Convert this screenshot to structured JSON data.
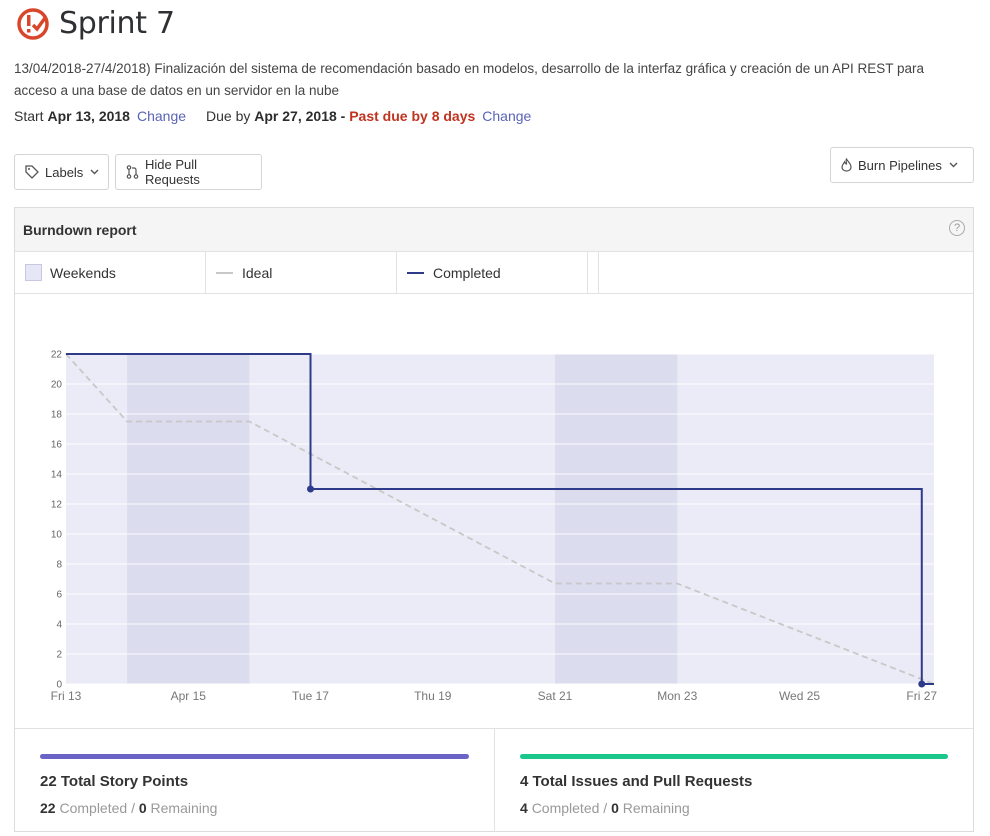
{
  "header": {
    "title": "Sprint 7",
    "logo_icon": "milestone-check-icon",
    "accent": "#d9472b"
  },
  "description": "13/04/2018-27/4/2018) Finalización del sistema de recomendación basado en modelos, desarrollo de la interfaz gráfica y creación de un API REST para acceso a una base de datos en un servidor en la nube",
  "dates": {
    "start_label": "Start",
    "start_value": "Apr 13, 2018",
    "change": "Change",
    "due_label": "Due by",
    "due_value": "Apr 27, 2018",
    "separator": "-",
    "past_due": "Past due by 8 days"
  },
  "toolbar": {
    "labels": "Labels",
    "hide_prs": "Hide Pull Requests",
    "burn": "Burn Pipelines"
  },
  "report": {
    "title": "Burndown report",
    "help": "?",
    "legend": {
      "weekends": "Weekends",
      "ideal": "Ideal",
      "completed": "Completed"
    }
  },
  "colors": {
    "completed": "#2e3b8a",
    "ideal": "#c8c8c8",
    "weekend": "#dcdcef",
    "background": "#ebebf7",
    "points_bar": "#6b63c5",
    "issues_bar": "#19c88a",
    "past_due": "#c0331f",
    "link": "#5a63b8"
  },
  "chart_data": {
    "type": "line",
    "title": "",
    "xlabel": "",
    "ylabel": "",
    "ylim": [
      0,
      22
    ],
    "yticks": [
      0,
      2,
      4,
      6,
      8,
      10,
      12,
      14,
      16,
      18,
      20,
      22
    ],
    "x_range_days": [
      0,
      14.2
    ],
    "xticks": [
      {
        "day": 0,
        "label": "Fri 13"
      },
      {
        "day": 2,
        "label": "Apr 15"
      },
      {
        "day": 4,
        "label": "Tue 17"
      },
      {
        "day": 6,
        "label": "Thu 19"
      },
      {
        "day": 8,
        "label": "Sat 21"
      },
      {
        "day": 10,
        "label": "Mon 23"
      },
      {
        "day": 12,
        "label": "Wed 25"
      },
      {
        "day": 14,
        "label": "Fri 27"
      }
    ],
    "weekends": [
      [
        1,
        3
      ],
      [
        8,
        10
      ]
    ],
    "series": [
      {
        "name": "Ideal",
        "style": "dashed",
        "points": [
          [
            0,
            22
          ],
          [
            1,
            17.5
          ],
          [
            3,
            17.5
          ],
          [
            8,
            6.7
          ],
          [
            10,
            6.7
          ],
          [
            14.2,
            0
          ]
        ]
      },
      {
        "name": "Completed",
        "style": "step",
        "points": [
          [
            0,
            22
          ],
          [
            4,
            22
          ],
          [
            4,
            13
          ],
          [
            14,
            13
          ],
          [
            14,
            0
          ],
          [
            14.2,
            0
          ]
        ],
        "markers": [
          [
            4,
            13
          ],
          [
            14,
            0
          ]
        ]
      }
    ]
  },
  "stats": {
    "points": {
      "title": "22 Total Story Points",
      "completed": "22",
      "completed_label": "Completed",
      "slash": "/",
      "remaining": "0",
      "remaining_label": "Remaining"
    },
    "issues": {
      "title": "4 Total Issues and Pull Requests",
      "completed": "4",
      "completed_label": "Completed",
      "slash": "/",
      "remaining": "0",
      "remaining_label": "Remaining"
    }
  }
}
